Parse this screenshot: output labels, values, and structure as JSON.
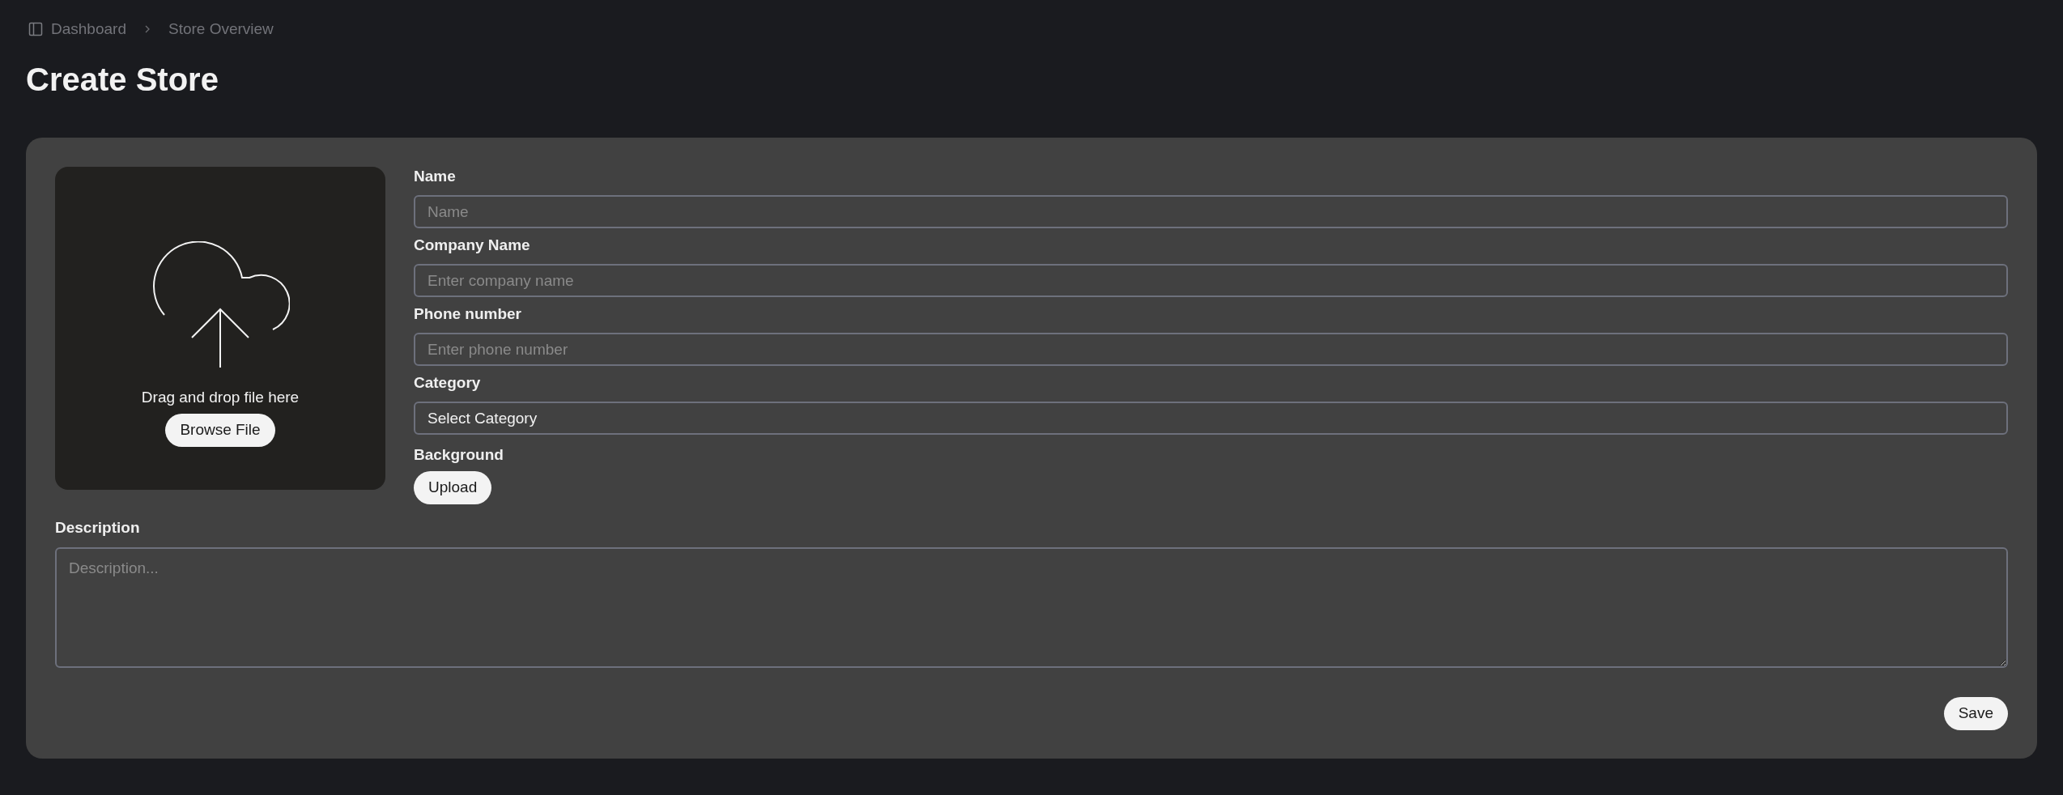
{
  "breadcrumb": [
    "Dashboard",
    "Store Overview"
  ],
  "title": "Create Store",
  "upload": {
    "text": "Drag and drop file here",
    "button": "Browse File"
  },
  "fields": [
    {
      "kind": "text",
      "label": "Name",
      "placeholder": "Name"
    },
    {
      "kind": "text",
      "label": "Company Name",
      "placeholder": "Enter company name"
    },
    {
      "kind": "text",
      "label": "Phone number",
      "placeholder": "Enter phone number"
    },
    {
      "kind": "select",
      "label": "Category",
      "value": "Select Category"
    }
  ],
  "background": {
    "label": "Background",
    "button": "Upload"
  },
  "description": {
    "label": "Description",
    "placeholder": "Description..."
  },
  "save_button": "Save"
}
